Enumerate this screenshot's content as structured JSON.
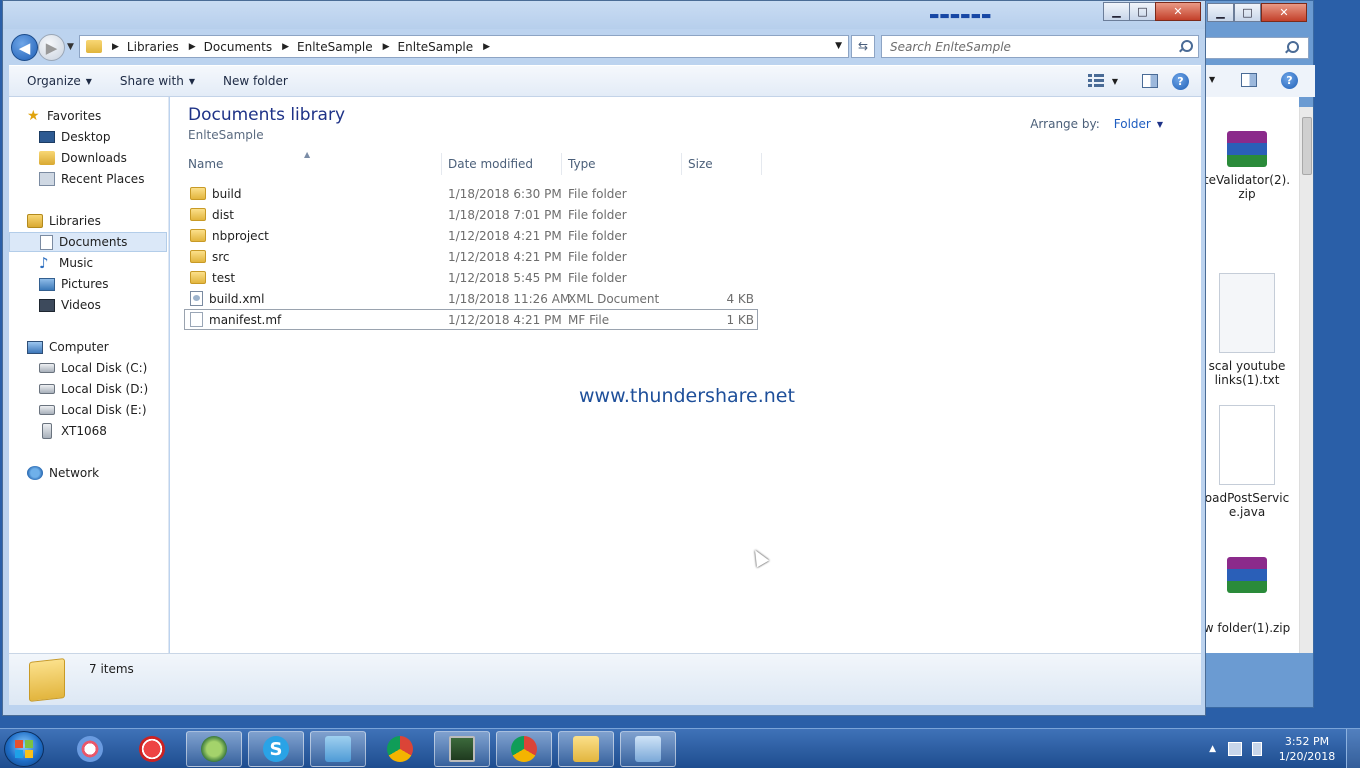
{
  "window": {
    "title_smudge": "▬▬▬▬▬▬"
  },
  "nav": {
    "breadcrumbs": [
      "Libraries",
      "Documents",
      "EnlteSample",
      "EnlteSample"
    ],
    "search_placeholder": "Search EnlteSample"
  },
  "toolbar": {
    "organize": "Organize",
    "share_with": "Share with",
    "new_folder": "New folder"
  },
  "navpane": {
    "favorites": "Favorites",
    "desktop": "Desktop",
    "downloads": "Downloads",
    "recent_places": "Recent Places",
    "libraries": "Libraries",
    "documents": "Documents",
    "music": "Music",
    "pictures": "Pictures",
    "videos": "Videos",
    "computer": "Computer",
    "disk_c": "Local Disk (C:)",
    "disk_d": "Local Disk (D:)",
    "disk_e": "Local Disk (E:)",
    "xt1068": "XT1068",
    "network": "Network"
  },
  "content": {
    "title": "Documents library",
    "subtitle": "EnlteSample",
    "arrange_label": "Arrange by:",
    "arrange_value": "Folder",
    "columns": {
      "name": "Name",
      "date": "Date modified",
      "type": "Type",
      "size": "Size"
    },
    "files": [
      {
        "name": "build",
        "date": "1/18/2018 6:30 PM",
        "type": "File folder",
        "size": "",
        "icon": "folder-icon"
      },
      {
        "name": "dist",
        "date": "1/18/2018 7:01 PM",
        "type": "File folder",
        "size": "",
        "icon": "folder-icon"
      },
      {
        "name": "nbproject",
        "date": "1/12/2018 4:21 PM",
        "type": "File folder",
        "size": "",
        "icon": "folder-icon"
      },
      {
        "name": "src",
        "date": "1/12/2018 4:21 PM",
        "type": "File folder",
        "size": "",
        "icon": "folder-icon"
      },
      {
        "name": "test",
        "date": "1/12/2018 5:45 PM",
        "type": "File folder",
        "size": "",
        "icon": "folder-icon"
      },
      {
        "name": "build.xml",
        "date": "1/18/2018 11:26 AM",
        "type": "XML Document",
        "size": "4 KB",
        "icon": "xml-file-icon"
      },
      {
        "name": "manifest.mf",
        "date": "1/12/2018 4:21 PM",
        "type": "MF File",
        "size": "1 KB",
        "icon": "file-icon"
      }
    ],
    "watermark": "www.thundershare.net"
  },
  "status": {
    "items": "7 items"
  },
  "desktop_items": {
    "zip1": "teValidator(2).\nzip",
    "txt": "scal youtube\nlinks(1).txt",
    "java": "oadPostServic\ne.java",
    "zip2": "w folder(1).zip"
  },
  "taskbar": {
    "time": "3:52 PM",
    "date": "1/20/2018"
  }
}
